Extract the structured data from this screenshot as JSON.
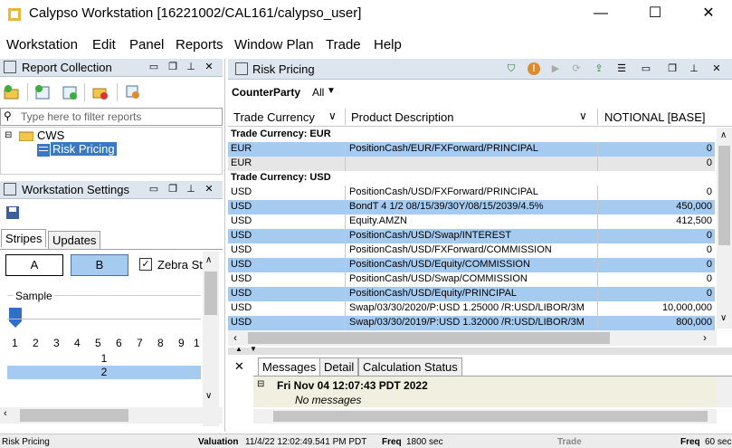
{
  "window": {
    "title": "Calypso Workstation [16221002/CAL161/calypso_user]",
    "min": "—",
    "max": "☐",
    "close": "✕"
  },
  "menu": [
    "Workstation",
    "Edit",
    "Panel",
    "Reports",
    "Window Plan",
    "Trade",
    "Help"
  ],
  "report_collection": {
    "title": "Report Collection",
    "filter_placeholder": "Type here to filter reports",
    "tree": {
      "root": "CWS",
      "child": "Risk Pricing"
    }
  },
  "ws_settings": {
    "title": "Workstation Settings",
    "tabs": [
      "Stripes",
      "Updates"
    ],
    "btn_a": "A",
    "btn_b": "B",
    "zebra": "Zebra St",
    "sample": "Sample",
    "ticks": [
      "1",
      "2",
      "3",
      "4",
      "5",
      "6",
      "7",
      "8",
      "9",
      "1"
    ],
    "list": [
      "1",
      "2"
    ]
  },
  "risk_pricing": {
    "title": "Risk Pricing",
    "counterparty_label": "CounterParty",
    "counterparty_value": "All",
    "columns": [
      "Trade Currency",
      "Product Description",
      "NOTIONAL [BASE]"
    ],
    "rows": [
      {
        "type": "group",
        "c1": "Trade Currency: EUR",
        "c2": "",
        "c3": ""
      },
      {
        "type": "blue",
        "c1": "EUR",
        "c2": "PositionCash/EUR/FXForward/PRINCIPAL",
        "c3": "0"
      },
      {
        "type": "gray",
        "c1": "EUR",
        "c2": "",
        "c3": "0"
      },
      {
        "type": "group",
        "c1": "Trade Currency: USD",
        "c2": "",
        "c3": ""
      },
      {
        "type": "white",
        "c1": "USD",
        "c2": "PositionCash/USD/FXForward/PRINCIPAL",
        "c3": "0"
      },
      {
        "type": "blue",
        "c1": "USD",
        "c2": "BondT 4 1/2 08/15/39/30Y/08/15/2039/4.5%",
        "c3": "450,000"
      },
      {
        "type": "white",
        "c1": "USD",
        "c2": "Equity.AMZN",
        "c3": "412,500"
      },
      {
        "type": "blue",
        "c1": "USD",
        "c2": "PositionCash/USD/Swap/INTEREST",
        "c3": "0"
      },
      {
        "type": "white",
        "c1": "USD",
        "c2": "PositionCash/USD/FXForward/COMMISSION",
        "c3": "0"
      },
      {
        "type": "blue",
        "c1": "USD",
        "c2": "PositionCash/USD/Equity/COMMISSION",
        "c3": "0"
      },
      {
        "type": "white",
        "c1": "USD",
        "c2": "PositionCash/USD/Swap/COMMISSION",
        "c3": "0"
      },
      {
        "type": "blue",
        "c1": "USD",
        "c2": "PositionCash/USD/Equity/PRINCIPAL",
        "c3": "0"
      },
      {
        "type": "white",
        "c1": "USD",
        "c2": "Swap/03/30/2020/P:USD 1.25000 /R:USD/LIBOR/3M",
        "c3": "10,000,000"
      },
      {
        "type": "blue",
        "c1": "USD",
        "c2": "Swap/03/30/2019/P:USD 1.32000 /R:USD/LIBOR/3M",
        "c3": "800,000"
      }
    ]
  },
  "messages": {
    "tabs": [
      "Messages",
      "Detail",
      "Calculation Status"
    ],
    "date": "Fri Nov 04 12:07:43 PDT 2022",
    "text": "No messages"
  },
  "status": {
    "left": "Risk Pricing",
    "valuation_label": "Valuation",
    "valuation": "11/4/22 12:02:49.541 PM PDT",
    "freq_label": "Freq",
    "freq": "1800 sec",
    "trade": "Trade",
    "freq2_label": "Freq",
    "freq2": "60 sec"
  },
  "colors": {
    "selection": "#a6cbf1",
    "header": "#dde5ee"
  }
}
